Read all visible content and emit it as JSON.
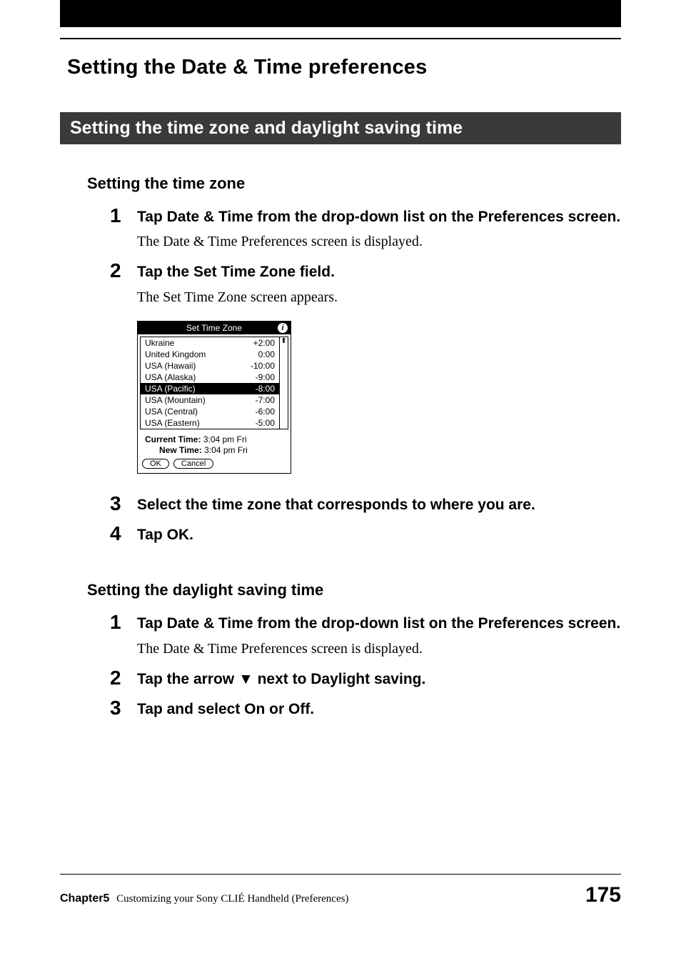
{
  "header": {
    "h1": "Setting the Date & Time preferences",
    "h2": "Setting the time zone and daylight saving time"
  },
  "sectionA": {
    "h3": "Setting the time zone",
    "steps": [
      {
        "num": "1",
        "title": "Tap Date & Time from the drop-down list on the Preferences screen.",
        "body": "The Date & Time Preferences screen is displayed."
      },
      {
        "num": "2",
        "title": "Tap the Set Time Zone field.",
        "body": "The Set Time Zone screen appears."
      },
      {
        "num": "3",
        "title": "Select the time zone that corresponds to where you are.",
        "body": ""
      },
      {
        "num": "4",
        "title": "Tap OK.",
        "body": ""
      }
    ]
  },
  "screenshot": {
    "title": "Set Time Zone",
    "info_icon": "i",
    "rows": [
      {
        "name": "Ukraine",
        "offset": "+2:00",
        "sel": false
      },
      {
        "name": "United Kingdom",
        "offset": "0:00",
        "sel": false
      },
      {
        "name": "USA (Hawaii)",
        "offset": "-10:00",
        "sel": false
      },
      {
        "name": "USA (Alaska)",
        "offset": "-9:00",
        "sel": false
      },
      {
        "name": "USA (Pacific)",
        "offset": "-8:00",
        "sel": true
      },
      {
        "name": "USA (Mountain)",
        "offset": "-7:00",
        "sel": false
      },
      {
        "name": "USA (Central)",
        "offset": "-6:00",
        "sel": false
      },
      {
        "name": "USA (Eastern)",
        "offset": "-5:00",
        "sel": false
      }
    ],
    "current_label": "Current Time:",
    "current_value": "3:04 pm Fri",
    "new_label": "New Time:",
    "new_value": "3:04 pm Fri",
    "ok": "OK",
    "cancel": "Cancel",
    "scroll_up": "⬆",
    "scroll_down": ""
  },
  "sectionB": {
    "h3": "Setting the daylight saving time",
    "steps": [
      {
        "num": "1",
        "title": "Tap Date & Time from the drop-down list on the Preferences screen.",
        "body": "The Date & Time Preferences screen is displayed."
      },
      {
        "num": "2",
        "title_pre": "Tap the arrow ",
        "arrow": "▼",
        "title_post": " next to Daylight saving.",
        "body": ""
      },
      {
        "num": "3",
        "title": "Tap and select On or Off.",
        "body": ""
      }
    ]
  },
  "footer": {
    "chapter": "Chapter5",
    "desc": "Customizing your Sony CLIÉ Handheld (Preferences)",
    "page": "175"
  }
}
